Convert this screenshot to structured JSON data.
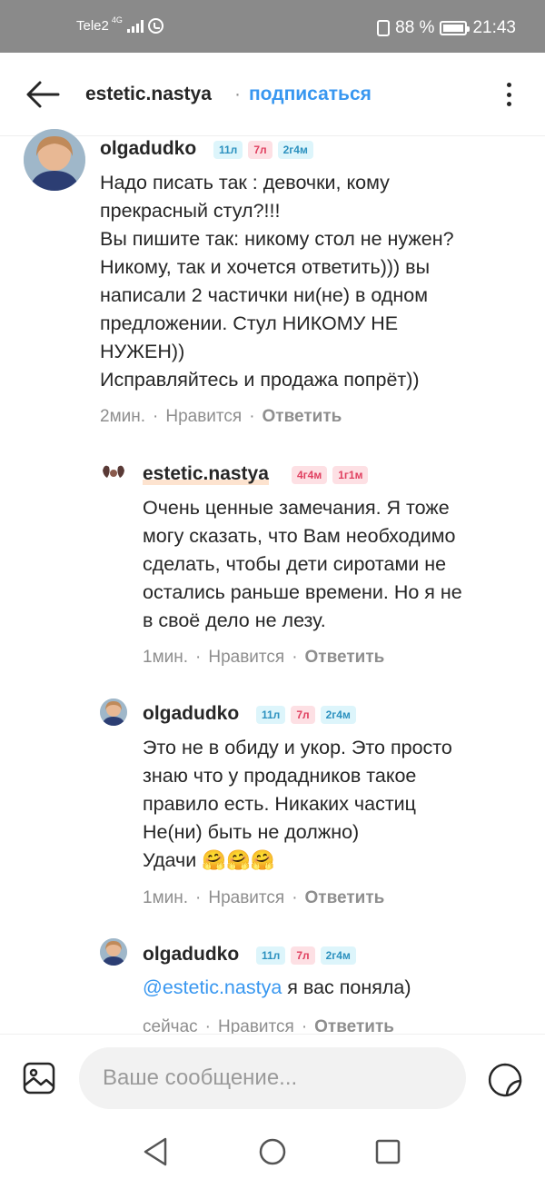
{
  "status_bar": {
    "carrier": "Tele2",
    "network": "4G",
    "battery": "88 %",
    "time": "21:43"
  },
  "header": {
    "username": "estetic.nastya",
    "separator": "·",
    "subscribe": "подписаться"
  },
  "comments": [
    {
      "username": "olgadudko",
      "badges": [
        "11л",
        "7л",
        "2г4м"
      ],
      "lines": [
        "Надо писать так : девочки, кому",
        "прекрасный стул?!!!",
        "Вы пишите так: никому стол не нужен?",
        "Никому, так и хочется ответить))) вы",
        "написали 2 частички ни(не) в одном",
        "предложении. Стул НИКОМУ НЕ",
        "НУЖЕН))",
        "Исправляйтесь и продажа попрёт))"
      ],
      "time": "2мин.",
      "like": "Нравится",
      "reply": "Ответить"
    },
    {
      "username": "estetic.nastya",
      "badges": [
        "4г4м",
        "1г1м"
      ],
      "lines": [
        "Очень ценные замечания. Я тоже",
        "могу сказать, что Вам необходимо",
        "сделать, чтобы дети сиротами не",
        "остались раньше времени. Но я не",
        "в своё дело не лезу."
      ],
      "time": "1мин.",
      "like": "Нравится",
      "reply": "Ответить"
    },
    {
      "username": "olgadudko",
      "badges": [
        "11л",
        "7л",
        "2г4м"
      ],
      "lines": [
        "Это не в обиду и укор. Это просто",
        "знаю что у продадников такое",
        "правило есть. Никаких частиц",
        "Не(ни) быть не должно)",
        "Удачи 🤗🤗🤗"
      ],
      "time": "1мин.",
      "like": "Нравится",
      "reply": "Ответить"
    },
    {
      "username": "olgadudko",
      "badges": [
        "11л",
        "7л",
        "2г4м"
      ],
      "mention": "@estetic.nastya",
      "text": " я вас поняла)",
      "time": "сейчас",
      "like": "Нравится",
      "reply": "Ответить"
    }
  ],
  "composer": {
    "placeholder": "Ваше сообщение..."
  },
  "icons": {
    "back": "arrow-left-icon",
    "menu": "more-vertical-icon",
    "gallery": "image-icon",
    "sticker": "sticker-icon",
    "nav_back": "triangle-back-icon",
    "nav_home": "circle-home-icon",
    "nav_recent": "square-recent-icon"
  },
  "colors": {
    "link": "#3897f0",
    "muted": "#8e8e8e",
    "status_bar": "#8a8a8a"
  }
}
